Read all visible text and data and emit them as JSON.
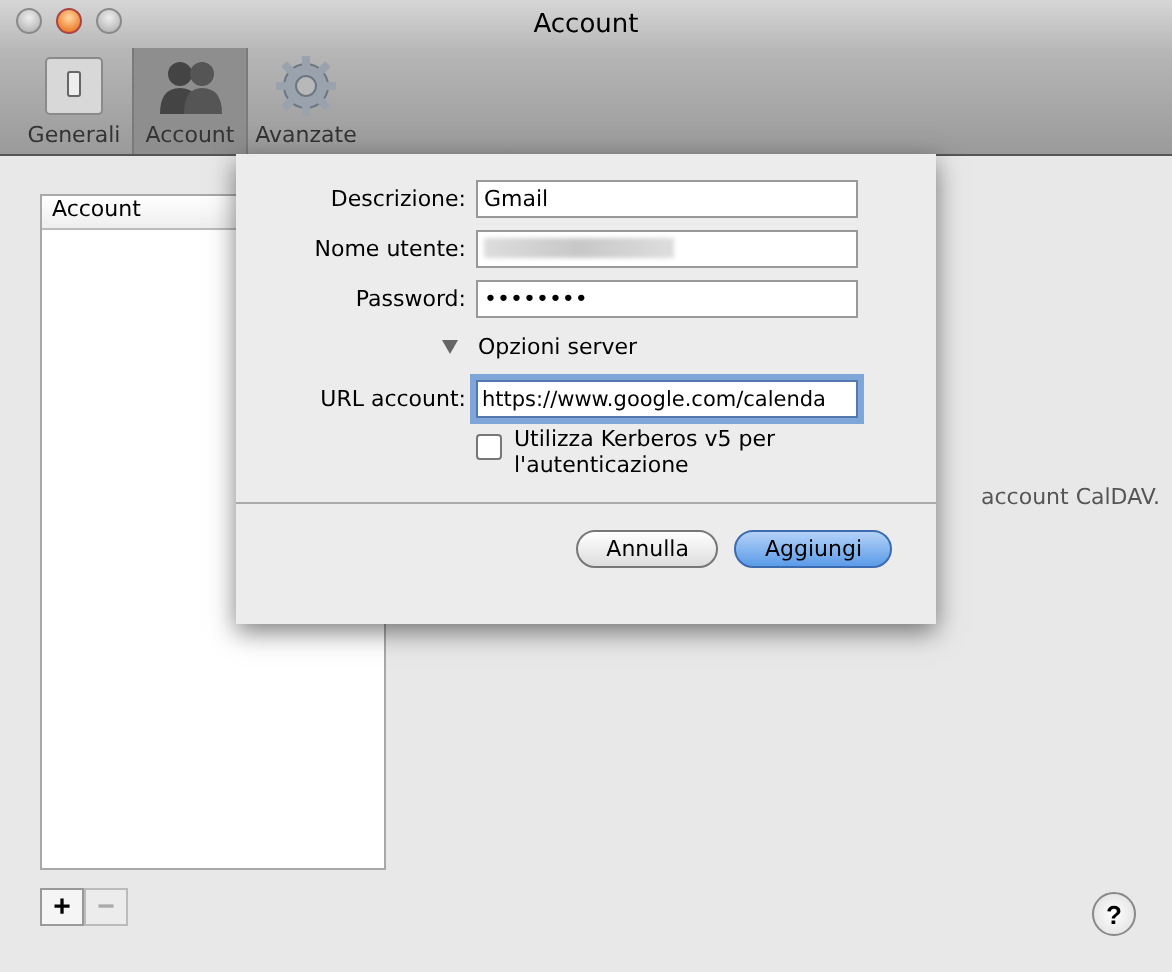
{
  "window": {
    "title": "Account"
  },
  "toolbar": [
    {
      "label": "Generali",
      "kind": "switch",
      "selected": false
    },
    {
      "label": "Account",
      "kind": "people",
      "selected": true
    },
    {
      "label": "Avanzate",
      "kind": "gear",
      "selected": false
    }
  ],
  "account_list": {
    "header": "Account"
  },
  "background_hint": "account CalDAV.",
  "sheet": {
    "fields": [
      {
        "label": "Descrizione:",
        "value": "Gmail",
        "kind": "text",
        "focused": false
      },
      {
        "label": "Nome utente:",
        "kind": "blurred",
        "focused": false
      },
      {
        "label": "Password:",
        "value": "••••••••",
        "kind": "text",
        "focused": false
      }
    ],
    "disclosure": {
      "label": "Opzioni server",
      "expanded": true
    },
    "url_field": {
      "label": "URL account:",
      "value": "https://www.google.com/calenda",
      "focused": true
    },
    "kerberos": {
      "label": "Utilizza Kerberos v5 per l'autenticazione",
      "checked": false
    },
    "buttons": [
      {
        "label": "Annulla",
        "kind": "cancel"
      },
      {
        "label": "Aggiungi",
        "kind": "default"
      }
    ]
  },
  "list_buttons": [
    {
      "label": "+",
      "disabled": false
    },
    {
      "label": "−",
      "disabled": true
    }
  ],
  "help": "?"
}
